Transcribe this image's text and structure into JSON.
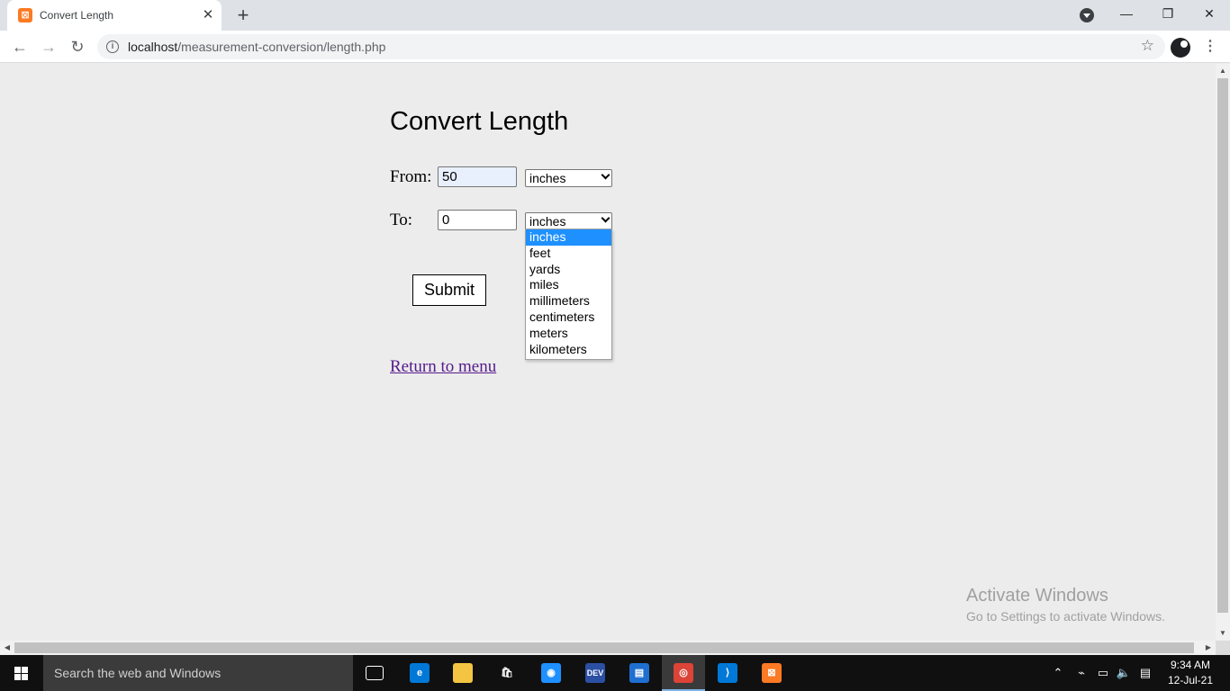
{
  "browser": {
    "tab_title": "Convert Length",
    "new_tab": "+",
    "tab_close": "✕",
    "url_host": "localhost",
    "url_path": "/measurement-conversion/length.php",
    "window": {
      "minimize": "—",
      "restore": "❐",
      "close": "✕"
    }
  },
  "page": {
    "title": "Convert Length",
    "from_label": "From:",
    "from_value": "50",
    "from_unit": "inches",
    "to_label": "To:",
    "to_value": "0",
    "to_unit": "inches",
    "unit_options": [
      "inches",
      "feet",
      "yards",
      "miles",
      "millimeters",
      "centimeters",
      "meters",
      "kilometers"
    ],
    "selected_option": "inches",
    "submit_label": "Submit",
    "return_link": "Return to menu"
  },
  "watermark": {
    "line1": "Activate Windows",
    "line2": "Go to Settings to activate Windows."
  },
  "taskbar": {
    "search_placeholder": "Search the web and Windows",
    "time": "9:34 AM",
    "date": "12-Jul-21",
    "apps": [
      {
        "name": "task-view",
        "color": "#101010",
        "glyph": "▭"
      },
      {
        "name": "edge",
        "color": "#0078d7",
        "glyph": "e"
      },
      {
        "name": "file-explorer",
        "color": "#f4c542",
        "glyph": ""
      },
      {
        "name": "store",
        "color": "#101010",
        "glyph": "🛍"
      },
      {
        "name": "media",
        "color": "#1e90ff",
        "glyph": "◉"
      },
      {
        "name": "dev",
        "color": "#2b4fa3",
        "glyph": "DEV"
      },
      {
        "name": "reader",
        "color": "#1f6fd0",
        "glyph": "▤"
      },
      {
        "name": "chrome",
        "color": "#db4437",
        "glyph": "◎"
      },
      {
        "name": "vscode",
        "color": "#0078d7",
        "glyph": "⟩"
      },
      {
        "name": "xampp",
        "color": "#fb7a24",
        "glyph": "⊠"
      }
    ]
  },
  "colors": {
    "accent_selected": "#1e90ff",
    "link_visited": "#551a8b",
    "autofill_bg": "#e8f0fe"
  }
}
